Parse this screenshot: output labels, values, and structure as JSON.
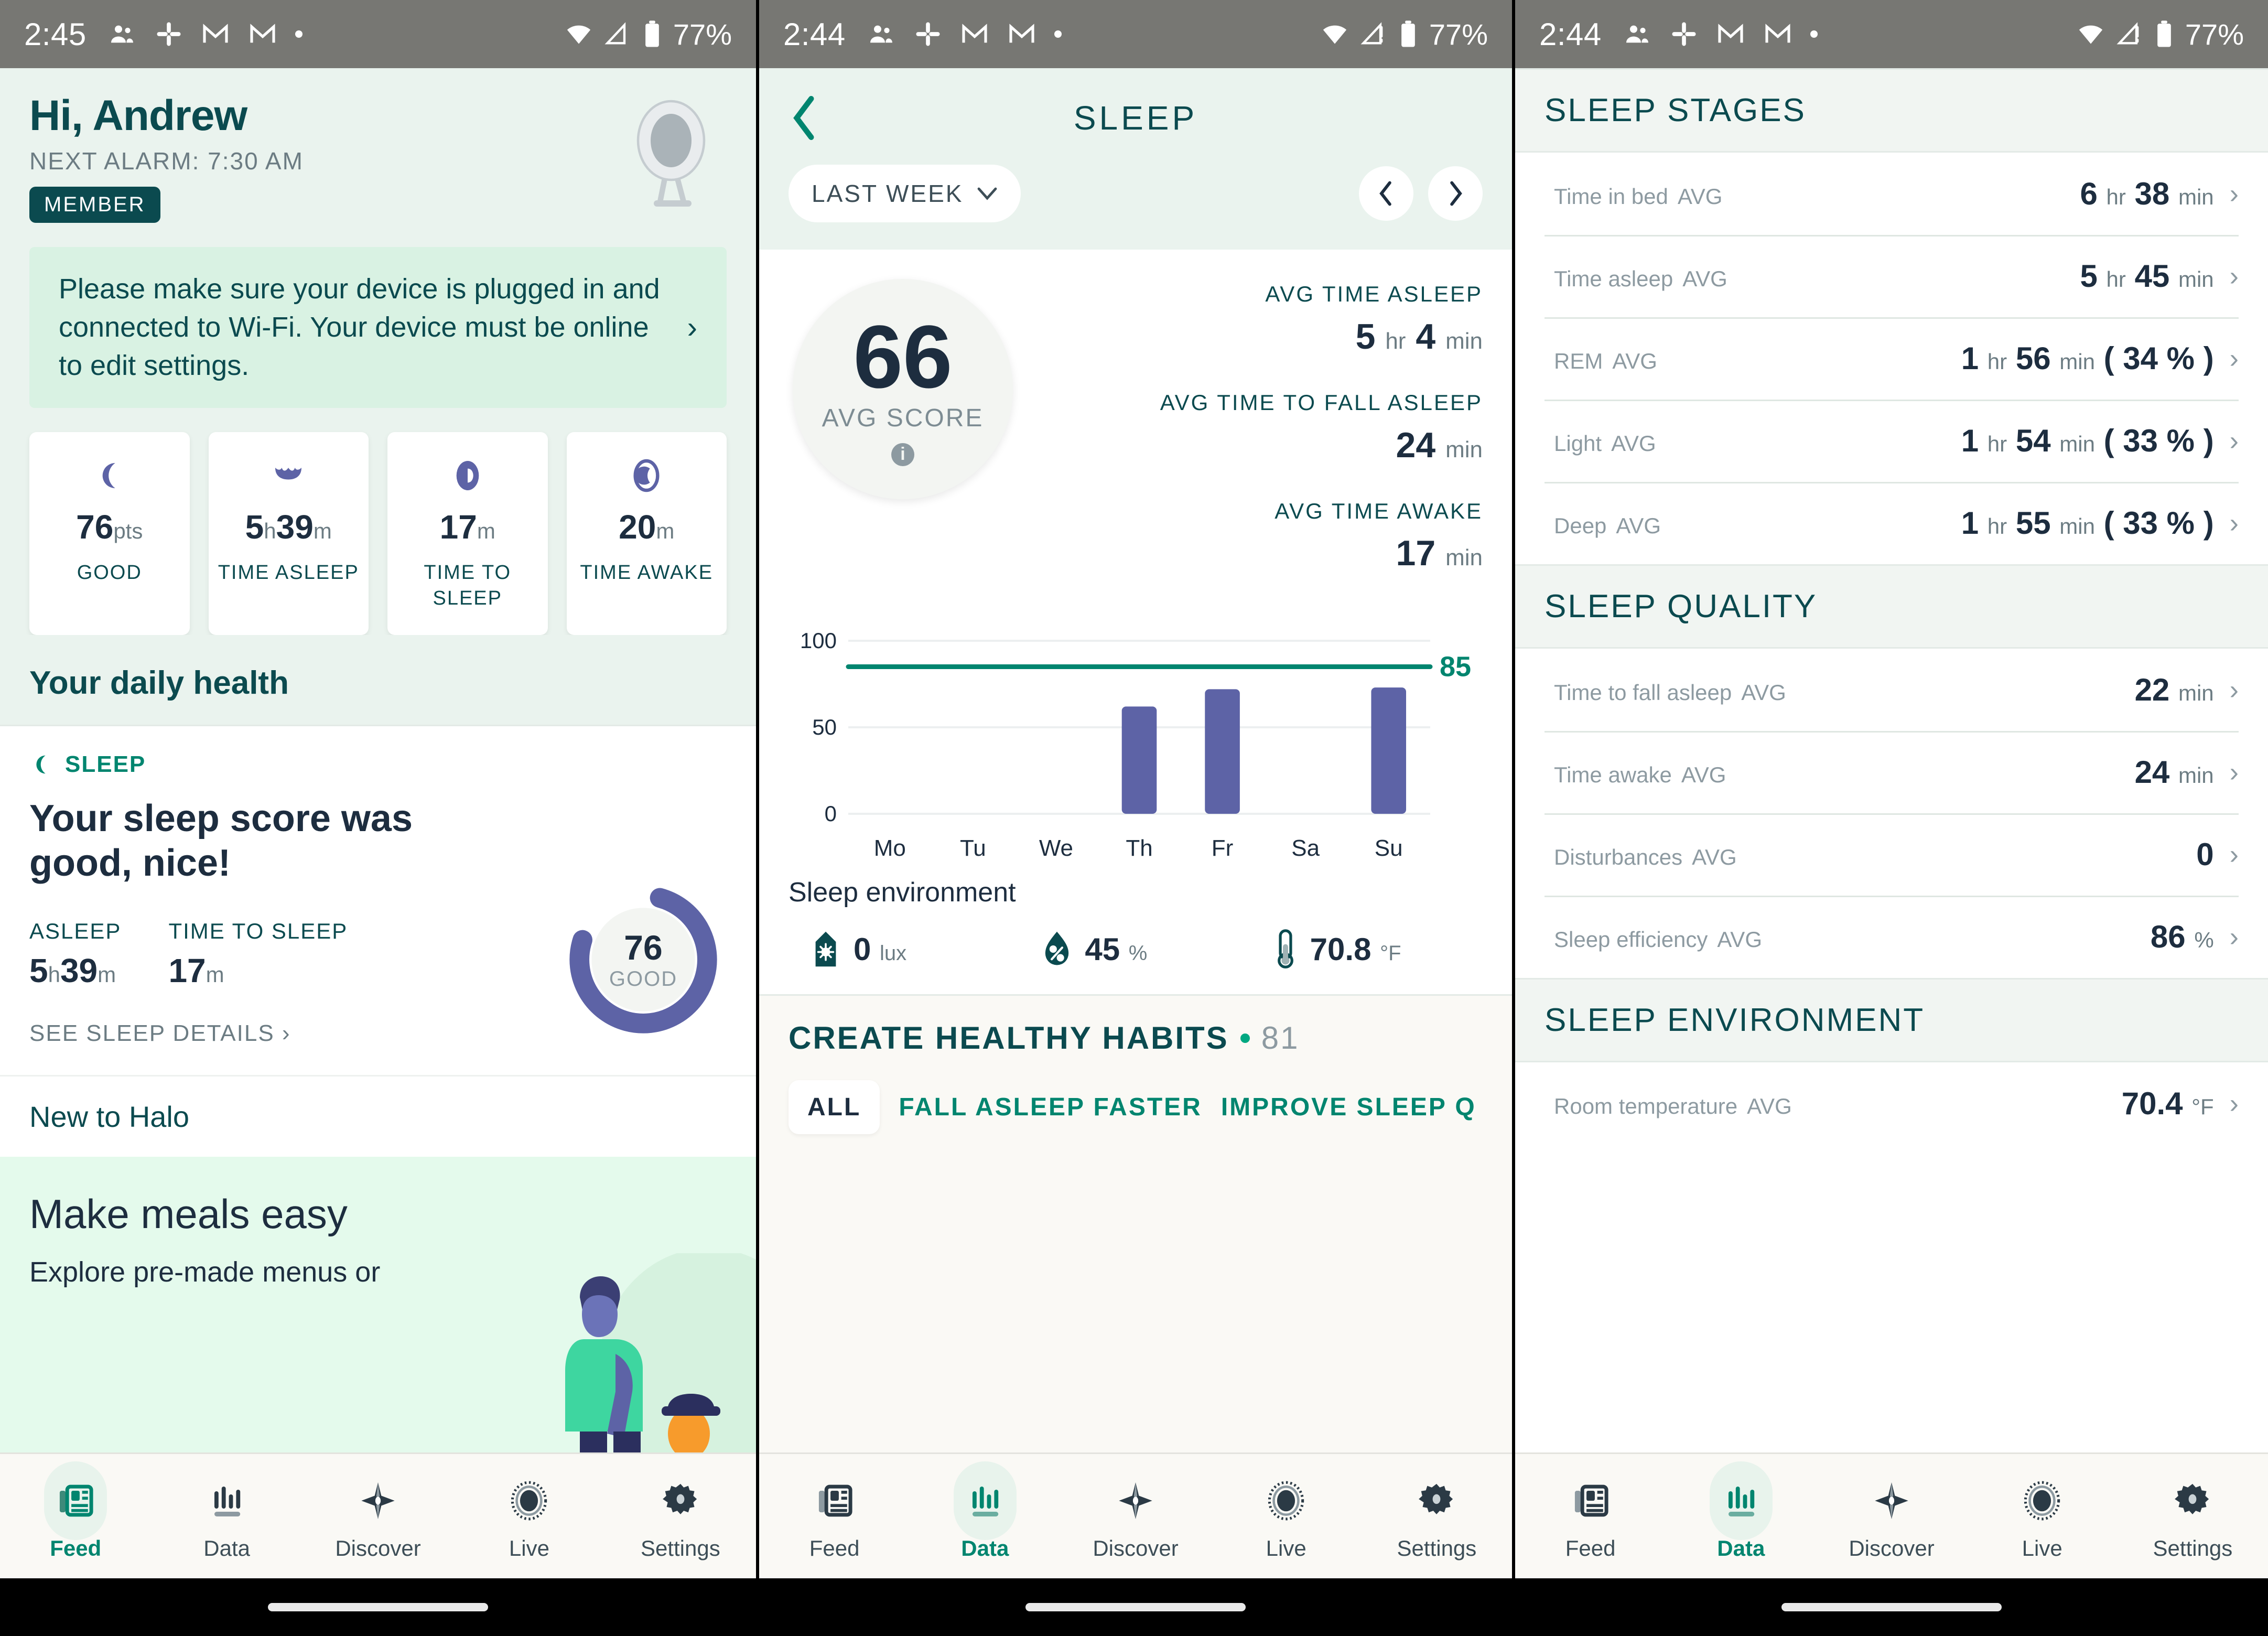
{
  "status_bars": [
    {
      "time": "2:45",
      "battery": "77%",
      "icons": [
        "people-icon",
        "slack-icon",
        "gmail-icon",
        "gmail-icon",
        "dot-icon"
      ],
      "right_icons": [
        "wifi-icon",
        "signal-icon",
        "battery-icon"
      ]
    },
    {
      "time": "2:44",
      "battery": "77%",
      "icons": [
        "people-icon",
        "slack-icon",
        "gmail-icon",
        "gmail-icon",
        "dot-icon"
      ],
      "right_icons": [
        "wifi-icon",
        "signal-icon",
        "battery-icon"
      ]
    },
    {
      "time": "2:44",
      "battery": "77%",
      "icons": [
        "people-icon",
        "slack-icon",
        "gmail-icon",
        "gmail-icon",
        "dot-icon"
      ],
      "right_icons": [
        "wifi-icon",
        "signal-icon",
        "battery-icon"
      ]
    }
  ],
  "panel1": {
    "greeting": "Hi, Andrew",
    "next_alarm": "NEXT ALARM: 7:30 AM",
    "member_badge": "MEMBER",
    "notice": "Please make sure your device is plugged in and connected to Wi-Fi. Your device must be online to edit settings.",
    "cards": [
      {
        "icon": "moon-icon",
        "value": "76",
        "unit": "pts",
        "label": "GOOD"
      },
      {
        "icon": "bed-icon",
        "value": "5",
        "unit": "h",
        "value2": "39",
        "unit2": "m",
        "label": "TIME ASLEEP"
      },
      {
        "icon": "eye-closed-icon",
        "value": "17",
        "unit": "m",
        "label": "TIME TO SLEEP"
      },
      {
        "icon": "eye-open-icon",
        "value": "20",
        "unit": "m",
        "label": "TIME AWAKE"
      }
    ],
    "daily_health_title": "Your daily health",
    "sleep": {
      "tag": "SLEEP",
      "headline": "Your sleep score was good, nice!",
      "asleep_label": "ASLEEP",
      "asleep_value": "5",
      "asleep_unit": "h",
      "asleep_value2": "39",
      "asleep_unit2": "m",
      "tts_label": "TIME TO SLEEP",
      "tts_value": "17",
      "tts_unit": "m",
      "link": "SEE SLEEP DETAILS ›",
      "ring_score": "76",
      "ring_label": "GOOD",
      "ring_percent": 76,
      "ring_color": "#5d63a6"
    },
    "new_to_halo": "New to Halo",
    "promo_title": "Make meals easy",
    "promo_sub": "Explore pre-made menus or"
  },
  "panel2": {
    "title": "SLEEP",
    "back_icon": "chevron-left-icon",
    "week_selector": "LAST WEEK",
    "prev_icon": "chevron-left-icon",
    "next_icon": "chevron-right-icon",
    "avg_score": "66",
    "avg_score_label": "AVG SCORE",
    "info_icon": "info-icon",
    "stats": [
      {
        "label": "AVG TIME ASLEEP",
        "value": "5",
        "unit": "hr",
        "value2": "4",
        "unit2": "min"
      },
      {
        "label": "AVG TIME TO FALL ASLEEP",
        "value": "24",
        "unit": "min"
      },
      {
        "label": "AVG TIME AWAKE",
        "value": "17",
        "unit": "min"
      }
    ],
    "environment": {
      "title": "Sleep environment",
      "items": [
        {
          "icon": "light-icon",
          "value": "0",
          "unit": "lux"
        },
        {
          "icon": "humidity-icon",
          "value": "45",
          "unit": "%"
        },
        {
          "icon": "thermometer-icon",
          "value": "70.8",
          "unit": "°F"
        }
      ]
    },
    "habits": {
      "title": "CREATE HEALTHY HABITS",
      "count": "81",
      "tabs": [
        "ALL",
        "FALL ASLEEP FASTER",
        "IMPROVE SLEEP Q"
      ]
    }
  },
  "panel3": {
    "sections": [
      {
        "title": "SLEEP STAGES",
        "rows": [
          {
            "label": "Time in bed",
            "qualifier": "AVG",
            "value": "6",
            "unit": "hr",
            "value2": "38",
            "unit2": "min"
          },
          {
            "label": "Time asleep",
            "qualifier": "AVG",
            "value": "5",
            "unit": "hr",
            "value2": "45",
            "unit2": "min"
          },
          {
            "label": "REM",
            "qualifier": "AVG",
            "value": "1",
            "unit": "hr",
            "value2": "56",
            "unit2": "min",
            "extra": "( 34 % )"
          },
          {
            "label": "Light",
            "qualifier": "AVG",
            "value": "1",
            "unit": "hr",
            "value2": "54",
            "unit2": "min",
            "extra": "( 33 % )"
          },
          {
            "label": "Deep",
            "qualifier": "AVG",
            "value": "1",
            "unit": "hr",
            "value2": "55",
            "unit2": "min",
            "extra": "( 33 % )"
          }
        ]
      },
      {
        "title": "SLEEP QUALITY",
        "rows": [
          {
            "label": "Time to fall asleep",
            "qualifier": "AVG",
            "value": "22",
            "unit": "min"
          },
          {
            "label": "Time awake",
            "qualifier": "AVG",
            "value": "24",
            "unit": "min"
          },
          {
            "label": "Disturbances",
            "qualifier": "AVG",
            "value": "0",
            "unit": ""
          },
          {
            "label": "Sleep efficiency",
            "qualifier": "AVG",
            "value": "86",
            "unit": "%"
          }
        ]
      },
      {
        "title": "SLEEP ENVIRONMENT",
        "rows": [
          {
            "label": "Room temperature",
            "qualifier": "AVG",
            "value": "70.4",
            "unit": "°F"
          }
        ]
      }
    ]
  },
  "tabbar": {
    "items": [
      {
        "label": "Feed",
        "icon": "feed-icon"
      },
      {
        "label": "Data",
        "icon": "bar-chart-icon"
      },
      {
        "label": "Discover",
        "icon": "compass-star-icon"
      },
      {
        "label": "Live",
        "icon": "live-ring-icon"
      },
      {
        "label": "Settings",
        "icon": "gear-icon"
      }
    ],
    "active_panel1": 0,
    "active_panel2": 1,
    "active_panel3": 1
  },
  "chart_data": {
    "type": "bar",
    "title": "",
    "categories": [
      "Mo",
      "Tu",
      "We",
      "Th",
      "Fr",
      "Sa",
      "Su"
    ],
    "values": [
      null,
      null,
      null,
      62,
      72,
      null,
      73
    ],
    "ylim": [
      0,
      100
    ],
    "yticks": [
      0,
      50,
      100
    ],
    "ytick_labels": [
      "0",
      "50",
      "100"
    ],
    "xlabel": "",
    "ylabel": "",
    "grid": true,
    "bar_color": "#5d63a6",
    "reference_line": {
      "value": 85,
      "label": "85",
      "color": "#00856f"
    }
  },
  "colors": {
    "brand_teal": "#0b4a4f",
    "accent_green": "#00856f",
    "purple": "#5d63a6",
    "dark_text": "#1d2d3f",
    "mint_bg": "#eaf3ee"
  }
}
